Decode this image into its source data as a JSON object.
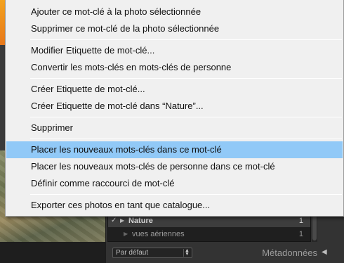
{
  "menu": {
    "items": [
      {
        "label": "Ajouter ce mot-clé à la photo sélectionnée"
      },
      {
        "label": "Supprimer ce mot-clé de la photo sélectionnée"
      },
      {
        "label": "Modifier Etiquette de mot-clé..."
      },
      {
        "label": "Convertir les mots-clés en mots-clés de personne"
      },
      {
        "label": "Créer Etiquette de mot-clé..."
      },
      {
        "label": "Créer Etiquette de mot-clé dans “Nature”..."
      },
      {
        "label": "Supprimer"
      },
      {
        "label": "Placer les nouveaux mots-clés dans ce mot-clé",
        "highlighted": true
      },
      {
        "label": "Placer les nouveaux mots-clés de personne dans ce mot-clé"
      },
      {
        "label": "Définir comme raccourci de mot-clé"
      },
      {
        "label": "Exporter ces photos en tant que catalogue..."
      }
    ],
    "highlight_color": "#91c9f7"
  },
  "keyword_list": {
    "rows": [
      {
        "check": "✓",
        "name": "Nature",
        "count": "1",
        "selected": true
      },
      {
        "check": "",
        "name": "vues aériennes",
        "count": "1",
        "selected": false
      }
    ]
  },
  "panel_footer": {
    "sort_select_value": "Par défaut",
    "next_panel_title": "Métadonnées"
  },
  "colors": {
    "menu_background": "#f0f0f0",
    "panel_background": "#333333",
    "title_bar_accent": "#f3a21e"
  }
}
